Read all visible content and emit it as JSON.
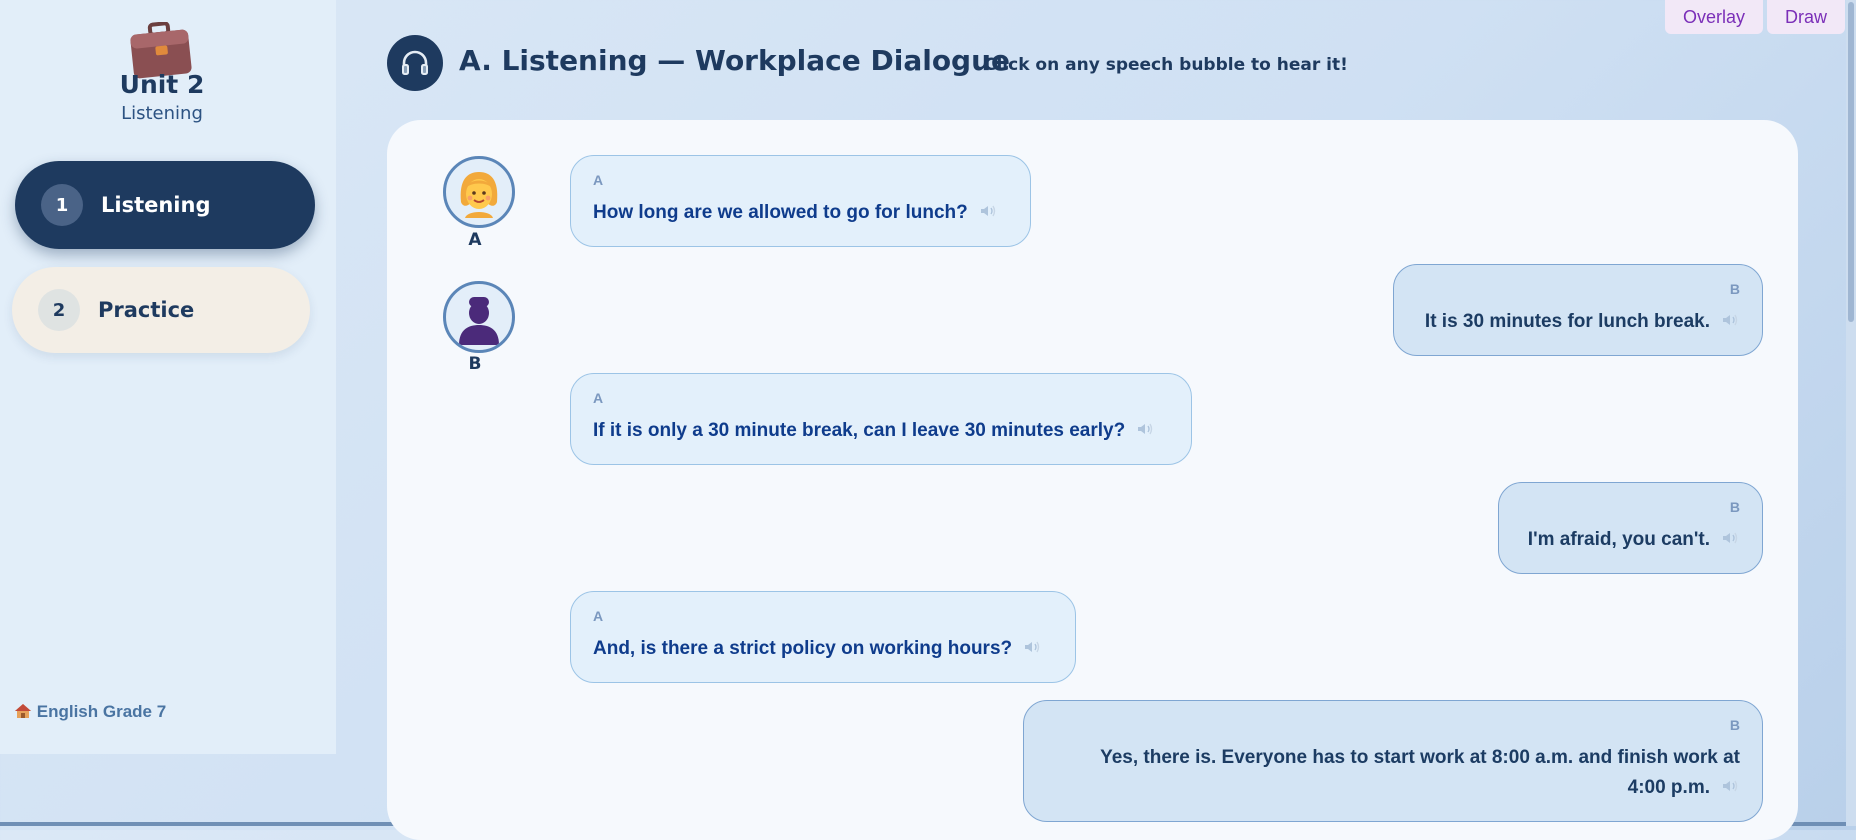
{
  "sidebar": {
    "unit_title": "Unit 2",
    "unit_subtitle": "Listening",
    "logo_icon": "briefcase-icon",
    "nav": [
      {
        "num": "1",
        "label": "Listening",
        "active": true
      },
      {
        "num": "2",
        "label": "Practice",
        "active": false
      }
    ],
    "footer": {
      "icon": "house-icon",
      "label": "English Grade 7"
    }
  },
  "toolbar": {
    "overlay_label": "Overlay",
    "draw_label": "Draw"
  },
  "header": {
    "icon": "headphones-icon",
    "title": "A. Listening — Workplace Dialogue",
    "subtitle": "Click on any speech bubble to hear it!"
  },
  "speakers": [
    {
      "label": "A",
      "avatar": "woman-avatar-icon"
    },
    {
      "label": "B",
      "avatar": "person-silhouette-icon"
    }
  ],
  "dialogue": [
    {
      "speaker": "A",
      "text": "How long are we allowed to go for lunch?"
    },
    {
      "speaker": "B",
      "text": "It is 30 minutes for lunch break."
    },
    {
      "speaker": "A",
      "text": "If it is only a 30 minute break, can I leave 30 minutes early?"
    },
    {
      "speaker": "B",
      "text": "I'm afraid, you can't."
    },
    {
      "speaker": "A",
      "text": "And, is there a strict policy on working hours?"
    },
    {
      "speaker": "B",
      "text_line1": "Yes, there is. Everyone has to start work at 8:00 a.m. and finish work at",
      "text_line2": "4:00 p.m."
    }
  ],
  "colors": {
    "primary": "#1e3a5f",
    "accent": "#7b2fb8",
    "bubble_a": "#e3f0fb",
    "bubble_b": "#d3e4f4"
  }
}
